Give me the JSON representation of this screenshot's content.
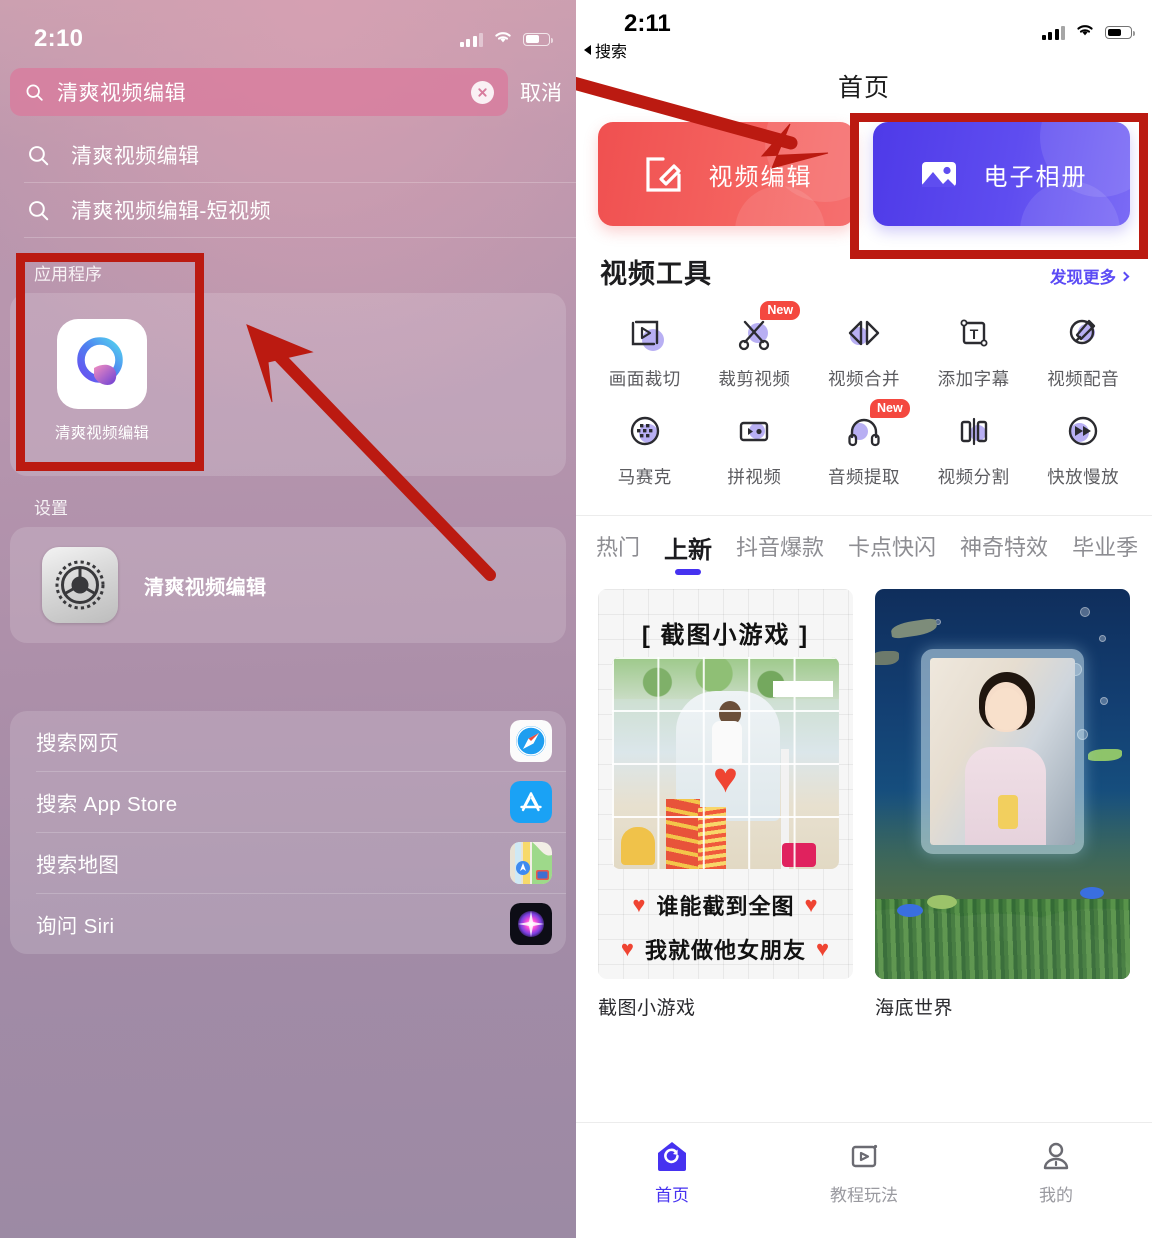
{
  "left_phone": {
    "status": {
      "time": "2:10",
      "signal_icon": "cellular-bars-icon",
      "wifi_icon": "wifi-icon",
      "battery_icon": "battery-icon"
    },
    "search": {
      "icon": "search-icon",
      "value": "清爽视频编辑",
      "clear_icon": "clear-circle-icon",
      "cancel_label": "取消"
    },
    "suggestions": [
      {
        "icon": "search-icon",
        "label": "清爽视频编辑"
      },
      {
        "icon": "search-icon",
        "label": "清爽视频编辑-短视频"
      }
    ],
    "applications": {
      "section_label": "应用程序",
      "app_name": "清爽视频编辑",
      "app_icon": "qingshuang-app-icon"
    },
    "settings": {
      "section_label": "设置",
      "item_label": "清爽视频编辑",
      "item_icon": "settings-gear-icon"
    },
    "actions": [
      {
        "label": "搜索网页",
        "icon": "safari-icon"
      },
      {
        "label": "搜索 App Store",
        "icon": "app-store-icon"
      },
      {
        "label": "搜索地图",
        "icon": "maps-icon"
      },
      {
        "label": "询问 Siri",
        "icon": "siri-icon"
      }
    ]
  },
  "right_phone": {
    "status": {
      "time": "2:11",
      "back_label": "搜索",
      "back_icon": "back-triangle-icon",
      "signal_icon": "cellular-bars-icon",
      "wifi_icon": "wifi-icon",
      "battery_icon": "battery-icon"
    },
    "page_title": "首页",
    "hero_cards": [
      {
        "label": "视频编辑",
        "icon": "edit-square-icon",
        "color": "#f05050"
      },
      {
        "label": "电子相册",
        "icon": "photo-album-icon",
        "color": "#4e3ae8"
      }
    ],
    "tools_section": {
      "title": "视频工具",
      "more_label": "发现更多",
      "more_icon": "chevron-right-icon",
      "items": [
        {
          "label": "画面裁切",
          "icon": "crop-frame-icon",
          "badge": ""
        },
        {
          "label": "裁剪视频",
          "icon": "scissors-icon",
          "badge": "New"
        },
        {
          "label": "视频合并",
          "icon": "merge-triangles-icon",
          "badge": ""
        },
        {
          "label": "添加字幕",
          "icon": "text-box-icon",
          "badge": ""
        },
        {
          "label": "视频配音",
          "icon": "mic-circle-icon",
          "badge": ""
        },
        {
          "label": "马赛克",
          "icon": "mosaic-circle-icon",
          "badge": ""
        },
        {
          "label": "拼视频",
          "icon": "splice-video-icon",
          "badge": ""
        },
        {
          "label": "音频提取",
          "icon": "headphones-icon",
          "badge": "New"
        },
        {
          "label": "视频分割",
          "icon": "split-icon",
          "badge": ""
        },
        {
          "label": "快放慢放",
          "icon": "fast-forward-icon",
          "badge": ""
        }
      ]
    },
    "category_tabs": [
      {
        "label": "热门",
        "active": false
      },
      {
        "label": "上新",
        "active": true
      },
      {
        "label": "抖音爆款",
        "active": false
      },
      {
        "label": "卡点快闪",
        "active": false
      },
      {
        "label": "神奇特效",
        "active": false
      },
      {
        "label": "毕业季",
        "active": false
      }
    ],
    "template_cards": [
      {
        "caption": "截图小游戏",
        "poster_title": "[ 截图小游戏 ]",
        "poster_line1": "谁能截到全图",
        "poster_line2": "我就做他女朋友"
      },
      {
        "caption": "海底世界"
      }
    ],
    "bottom_nav": [
      {
        "label": "首页",
        "icon": "home-icon",
        "active": true
      },
      {
        "label": "教程玩法",
        "icon": "tutorial-play-icon",
        "active": false
      },
      {
        "label": "我的",
        "icon": "profile-person-icon",
        "active": false
      }
    ]
  },
  "annotations": {
    "color": "#bb1a11",
    "boxes": [
      "app-result-highlight-box",
      "photo-album-highlight-box"
    ],
    "arrows": [
      "arrow-to-app-result",
      "arrow-to-photo-album"
    ]
  }
}
